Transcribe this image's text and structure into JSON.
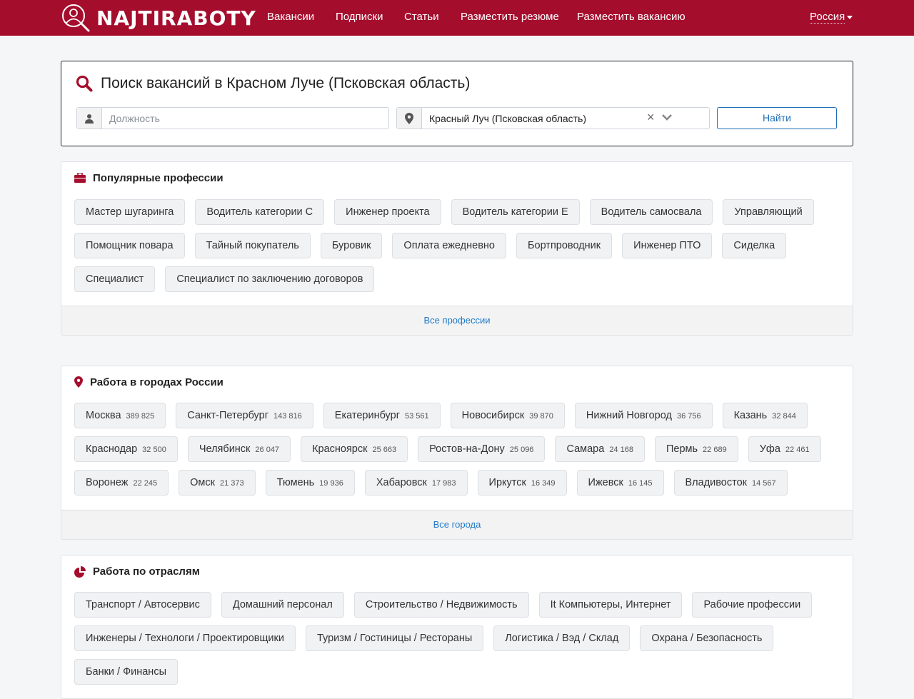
{
  "header": {
    "logo_text": "NAJTIRABOTY",
    "nav": [
      "Вакансии",
      "Подписки",
      "Статьи",
      "Разместить резюме",
      "Разместить вакансию"
    ],
    "country": "Россия",
    "brand_color": "#a50d2d"
  },
  "search": {
    "title": "Поиск вакансий в Красном Луче (Псковская область)",
    "position_placeholder": "Должность",
    "location_value": "Красный Луч (Псковская область)",
    "find_label": "Найти"
  },
  "professions": {
    "title": "Популярные профессии",
    "items": [
      "Мастер шугаринга",
      "Водитель категории С",
      "Инженер проекта",
      "Водитель категории Е",
      "Водитель самосвала",
      "Управляющий",
      "Помощник повара",
      "Тайный покупатель",
      "Буровик",
      "Оплата ежедневно",
      "Бортпроводник",
      "Инженер ПТО",
      "Сиделка",
      "Специалист",
      "Специалист по заключению договоров"
    ],
    "all_label": "Все профессии"
  },
  "cities": {
    "title": "Работа в городах России",
    "items": [
      {
        "name": "Москва",
        "count": "389 825"
      },
      {
        "name": "Санкт-Петербург",
        "count": "143 816"
      },
      {
        "name": "Екатеринбург",
        "count": "53 561"
      },
      {
        "name": "Новосибирск",
        "count": "39 870"
      },
      {
        "name": "Нижний Новгород",
        "count": "36 756"
      },
      {
        "name": "Казань",
        "count": "32 844"
      },
      {
        "name": "Краснодар",
        "count": "32 500"
      },
      {
        "name": "Челябинск",
        "count": "26 047"
      },
      {
        "name": "Красноярск",
        "count": "25 663"
      },
      {
        "name": "Ростов-на-Дону",
        "count": "25 096"
      },
      {
        "name": "Самара",
        "count": "24 168"
      },
      {
        "name": "Пермь",
        "count": "22 689"
      },
      {
        "name": "Уфа",
        "count": "22 461"
      },
      {
        "name": "Воронеж",
        "count": "22 245"
      },
      {
        "name": "Омск",
        "count": "21 373"
      },
      {
        "name": "Тюмень",
        "count": "19 936"
      },
      {
        "name": "Хабаровск",
        "count": "17 983"
      },
      {
        "name": "Иркутск",
        "count": "16 349"
      },
      {
        "name": "Ижевск",
        "count": "16 145"
      },
      {
        "name": "Владивосток",
        "count": "14 567"
      }
    ],
    "all_label": "Все города"
  },
  "industries": {
    "title": "Работа по отраслям",
    "items": [
      "Транспорт / Автосервис",
      "Домашний персонал",
      "Строительство / Недвижимость",
      "It Компьютеры, Интернет",
      "Рабочие профессии",
      "Инженеры / Технологи / Проектировщики",
      "Туризм / Гостиницы / Рестораны",
      "Логистика / Вэд / Склад",
      "Охрана / Безопасность",
      "Банки / Финансы"
    ]
  }
}
